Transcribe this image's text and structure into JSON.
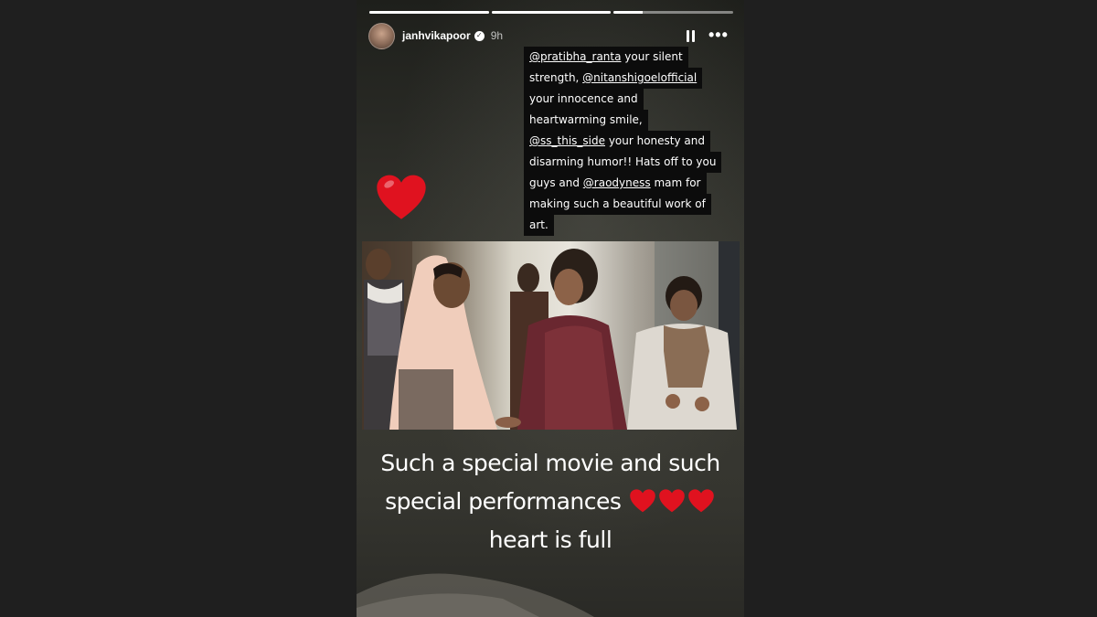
{
  "story": {
    "progress": [
      1.0,
      1.0,
      0.24
    ],
    "username": "janhvikapoor",
    "time": "9h",
    "caption_lines": [
      [
        {
          "text": "@pratibha_ranta",
          "mention": true
        },
        {
          "text": " your silent",
          "mention": false
        }
      ],
      [
        {
          "text": "strength, ",
          "mention": false
        },
        {
          "text": "@nitanshigoelofficial",
          "mention": true
        }
      ],
      [
        {
          "text": "your innocence and",
          "mention": false
        }
      ],
      [
        {
          "text": "heartwarming smile,",
          "mention": false
        }
      ],
      [
        {
          "text": "@ss_this_side",
          "mention": true
        },
        {
          "text": " your honesty and",
          "mention": false
        }
      ],
      [
        {
          "text": "disarming humor!! Hats off to you",
          "mention": false
        }
      ],
      [
        {
          "text": "guys and ",
          "mention": false
        },
        {
          "text": "@raodyness",
          "mention": true
        },
        {
          "text": " mam for",
          "mention": false
        }
      ],
      [
        {
          "text": "making such a beautiful work of",
          "mention": false
        }
      ],
      [
        {
          "text": "art.",
          "mention": false
        }
      ]
    ],
    "bottom_line1": "Such a special movie and such",
    "bottom_line2": "special performances",
    "bottom_line3": "heart is full"
  },
  "colors": {
    "heart": "#e0121f",
    "caption_bg": "#0c0c0c"
  },
  "icons": {
    "pause": "pause-icon",
    "more": "more-options-icon",
    "verified": "verified-badge-icon",
    "heart": "red-heart-emoji"
  }
}
